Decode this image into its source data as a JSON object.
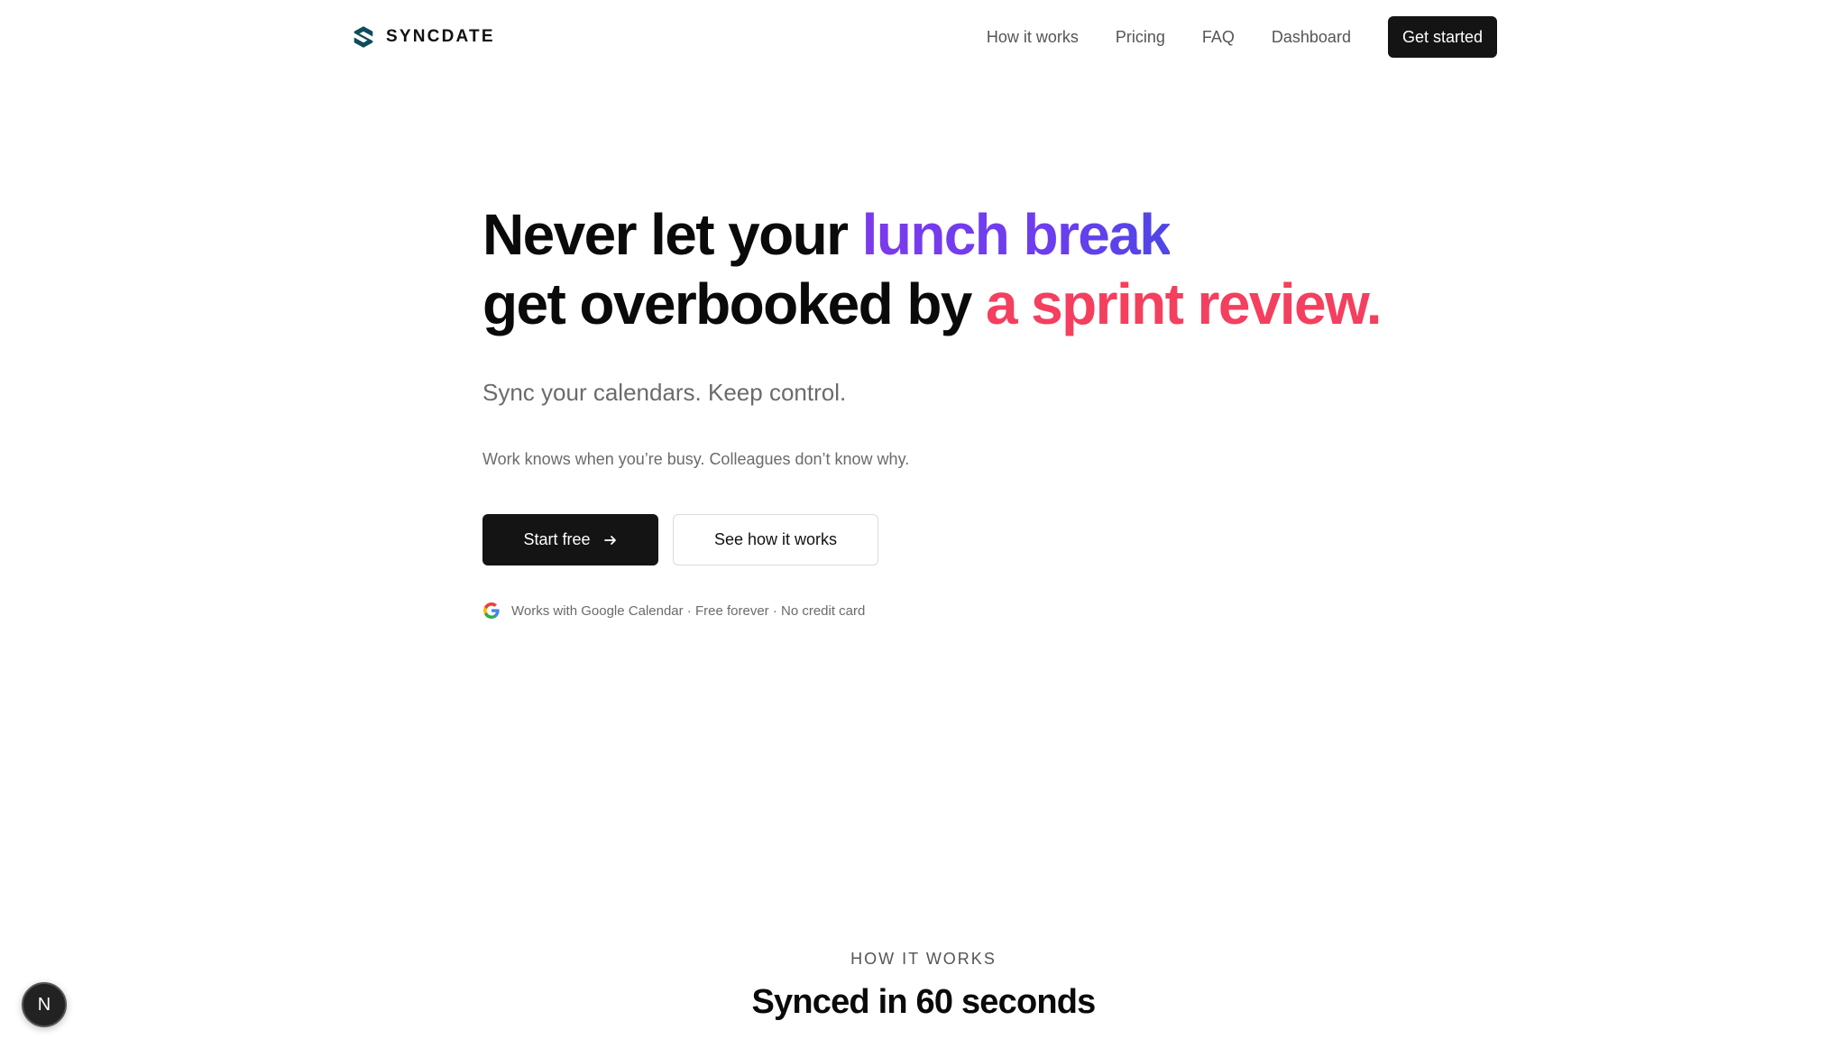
{
  "brand": {
    "name": "SYNCDATE",
    "logo_icon": "s-logo-icon",
    "color": "#0f4c5c"
  },
  "nav": {
    "links": [
      "How it works",
      "Pricing",
      "FAQ",
      "Dashboard"
    ],
    "cta": "Get started"
  },
  "hero": {
    "line1_pre": "Never let your ",
    "line1_highlight": "lunch break",
    "line2_pre": "get overbooked by ",
    "line2_highlight": "a sprint review.",
    "highlight_purple": "#6d3df0",
    "highlight_red": "#f43f5e",
    "subtitle": "Sync your calendars. Keep control.",
    "tagline": "Work knows when you’re busy. Colleagues don’t know why.",
    "primary_cta": "Start free",
    "secondary_cta": "See how it works",
    "trust_line": "Works with Google Calendar · Free forever · No credit card"
  },
  "how_it_works": {
    "eyebrow": "HOW IT WORKS",
    "title": "Synced in 60 seconds"
  },
  "badge": {
    "letter": "N"
  }
}
